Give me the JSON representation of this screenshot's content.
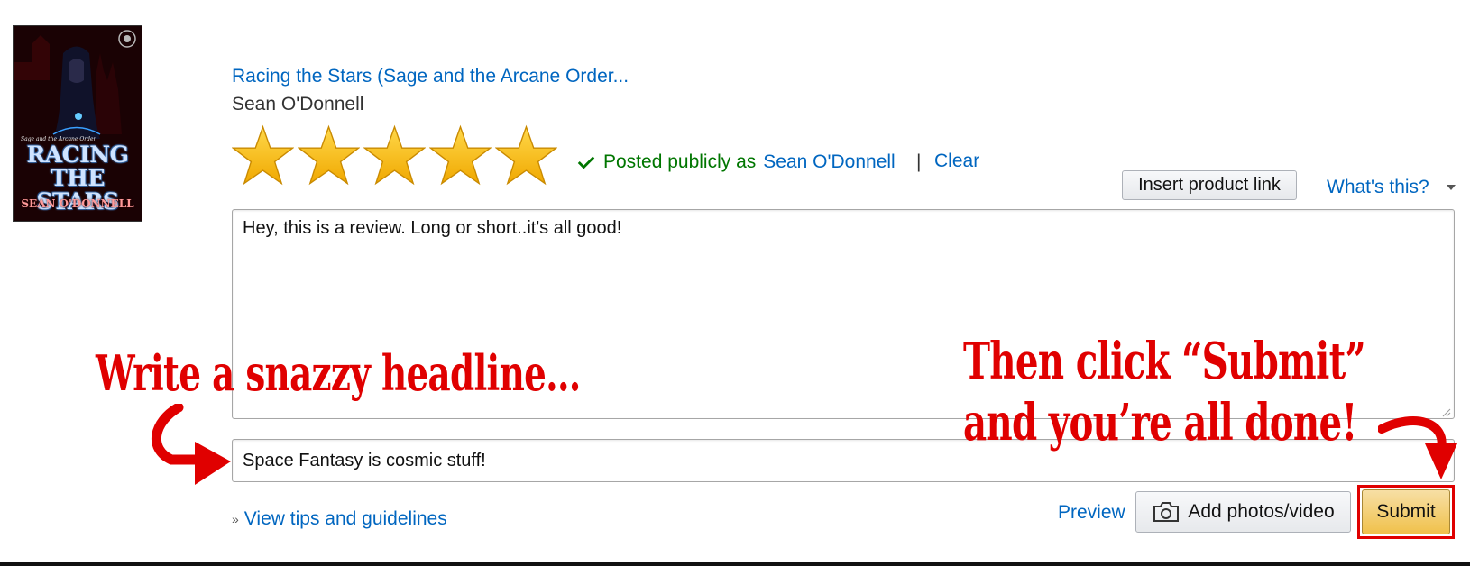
{
  "product": {
    "cover": {
      "series": "Sage and the Arcane Order",
      "title": "RACING THE STARS",
      "author": "SEAN O'DONNELL"
    },
    "title": "Racing the Stars (Sage and the Arcane Order...",
    "author": "Sean O'Donnell"
  },
  "rating": {
    "stars_filled": 5,
    "stars_total": 5,
    "star_color": "#f5b800"
  },
  "posting": {
    "status_prefix": "Posted publicly as",
    "user_name": "Sean O'Donnell",
    "separator": "|",
    "clear_label": "Clear"
  },
  "toolbar": {
    "insert_link_label": "Insert product link",
    "whats_this_label": "What's this?"
  },
  "review": {
    "body_value": "Hey, this is a review. Long or short..it's all good!",
    "headline_value": "Space Fantasy is cosmic stuff!"
  },
  "footer": {
    "tips_label": "View tips and guidelines",
    "preview_label": "Preview",
    "add_media_label": "Add photos/video",
    "submit_label": "Submit"
  },
  "annotations": {
    "headline_hint": "Write a snazzy headline...",
    "submit_hint_line1": "Then click “Submit”",
    "submit_hint_line2": "and you’re all done!",
    "annotation_color": "#e00000"
  },
  "colors": {
    "link": "#0066c0",
    "success": "#007600",
    "submit_button": "#f0c14b"
  }
}
